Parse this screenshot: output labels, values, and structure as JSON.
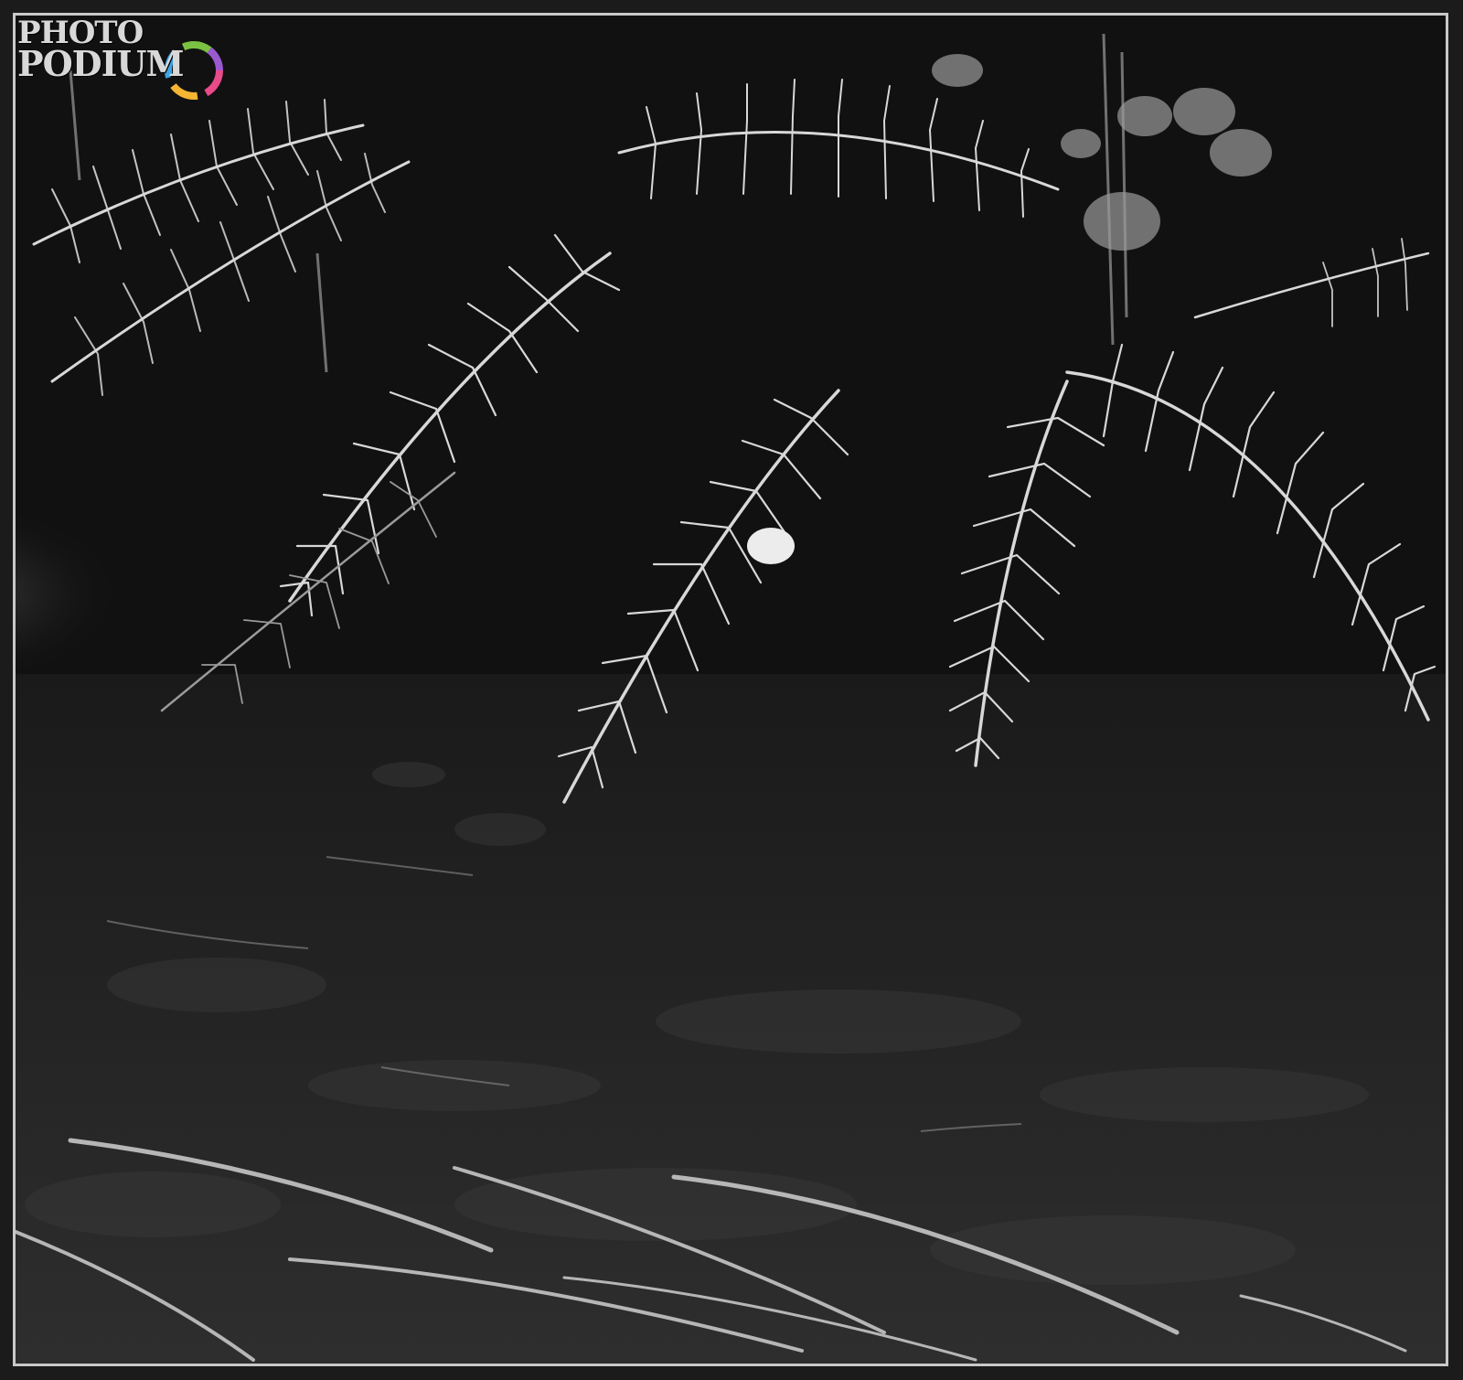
{
  "image": {
    "description_free": true,
    "frame_color": "#1b1b1b",
    "border_color": "#c9c9c9"
  },
  "watermark": {
    "line1": "PHOTO",
    "line2": "PODIUM",
    "logo_colors": [
      "#e84a8a",
      "#f4b533",
      "#3aa4e6",
      "#7bc142",
      "#9b59d0"
    ]
  }
}
